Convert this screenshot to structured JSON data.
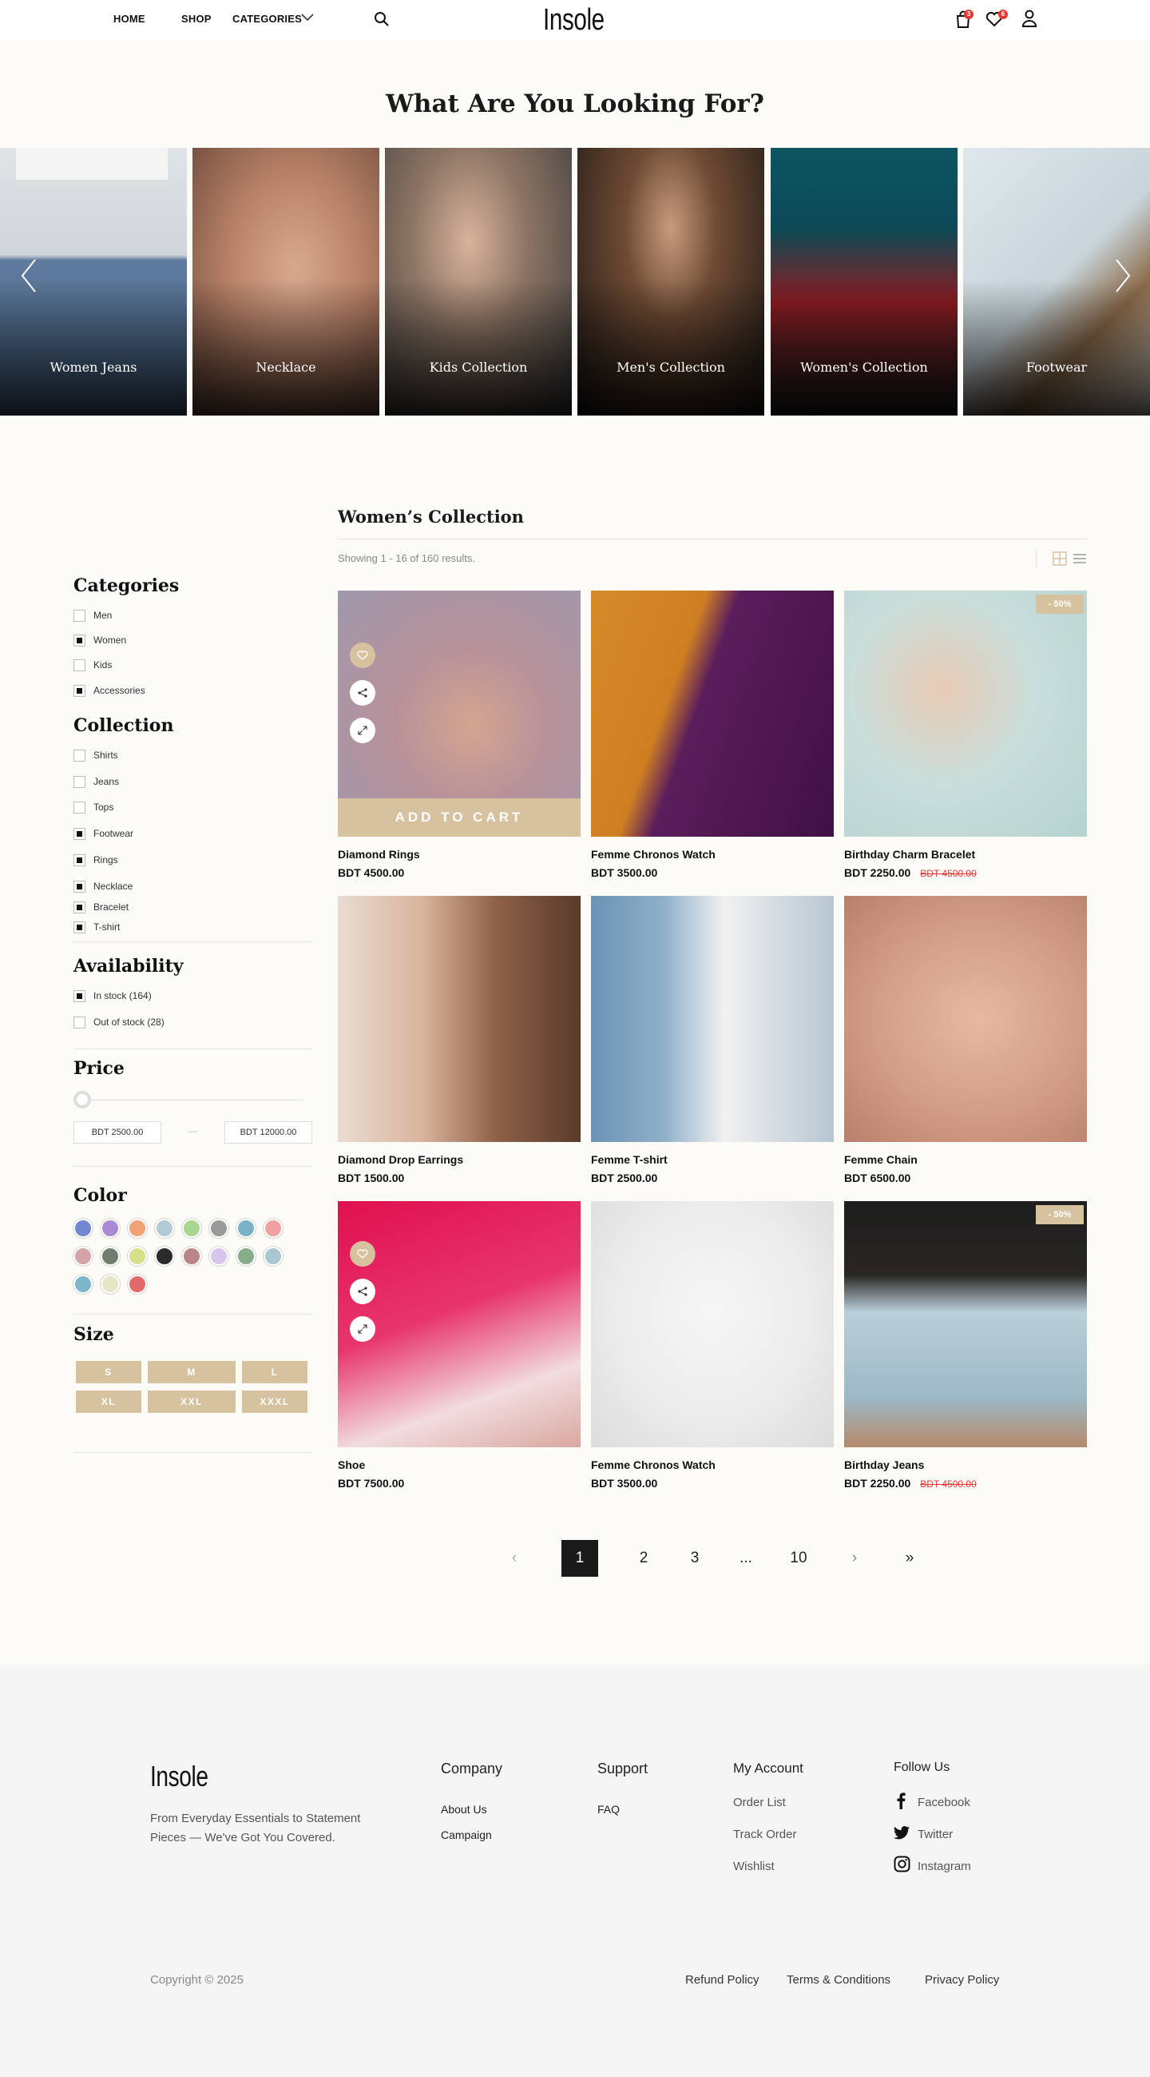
{
  "header": {
    "nav": [
      "HOME",
      "SHOP",
      "CATEGORIES"
    ],
    "logo": "Insole",
    "cart_count": "3",
    "wishlist_count": "6"
  },
  "hero": {
    "title": "What Are You Looking For?",
    "categories": [
      "Women Jeans",
      "Necklace",
      "Kids Collection",
      "Men's Collection",
      "Women's Collection",
      "Footwear"
    ]
  },
  "listing": {
    "title": "Women’s Collection",
    "results": "Showing 1 - 16 of 160 results."
  },
  "sidebar": {
    "categories_title": "Categories",
    "categories": [
      {
        "label": "Men",
        "checked": false
      },
      {
        "label": "Women",
        "checked": true
      },
      {
        "label": "Kids",
        "checked": false
      },
      {
        "label": "Accessories",
        "checked": true
      }
    ],
    "collection_title": "Collection",
    "collection": [
      {
        "label": "Shirts",
        "checked": false
      },
      {
        "label": "Jeans",
        "checked": false
      },
      {
        "label": "Tops",
        "checked": false
      },
      {
        "label": "Footwear",
        "checked": true
      },
      {
        "label": "Rings",
        "checked": true
      },
      {
        "label": "Necklace",
        "checked": true
      },
      {
        "label": "Bracelet",
        "checked": true
      },
      {
        "label": "T-shirt",
        "checked": true
      }
    ],
    "availability_title": "Availability",
    "availability": [
      {
        "label": "In stock (164)",
        "checked": true
      },
      {
        "label": "Out of stock (28)",
        "checked": false
      }
    ],
    "price_title": "Price",
    "price_min": "BDT 2500.00",
    "price_sep": "—",
    "price_max": "BDT 12000.00",
    "color_title": "Color",
    "colors": [
      "#6f88cf",
      "#a98ad4",
      "#f0a274",
      "#b3cbd6",
      "#a9d68e",
      "#9a9a9a",
      "#7ab3c8",
      "#f2a0a0",
      "#d6a3a6",
      "#6f7d6f",
      "#d9e08a",
      "#2b2b2b",
      "#b98685",
      "#d7c6ec",
      "#86ad8c",
      "#a9c8d4",
      "#7fb7ca",
      "#e6e6c4",
      "#e26a6a"
    ],
    "size_title": "Size",
    "sizes": [
      "S",
      "M",
      "L",
      "XL",
      "XXL",
      "XXXL"
    ]
  },
  "products": [
    {
      "name": "Diamond Rings",
      "price": "BDT 4500.00",
      "old": "",
      "sale": "",
      "cta": "ADD TO CART"
    },
    {
      "name": "Femme Chronos Watch",
      "price": "BDT 3500.00",
      "old": "",
      "sale": ""
    },
    {
      "name": "Birthday Charm Bracelet",
      "price": "BDT 2250.00",
      "old": "BDT 4500.00",
      "sale": "- 50%"
    },
    {
      "name": "Diamond Drop Earrings",
      "price": "BDT 1500.00",
      "old": "",
      "sale": ""
    },
    {
      "name": "Femme T-shirt",
      "price": "BDT 2500.00",
      "old": "",
      "sale": ""
    },
    {
      "name": "Femme Chain",
      "price": "BDT 6500.00",
      "old": "",
      "sale": ""
    },
    {
      "name": "Shoe",
      "price": "BDT 7500.00",
      "old": "",
      "sale": ""
    },
    {
      "name": "Femme Chronos Watch",
      "price": "BDT 3500.00",
      "old": "",
      "sale": ""
    },
    {
      "name": "Birthday Jeans",
      "price": "BDT 2250.00",
      "old": "BDT 4500.00",
      "sale": "- 50%"
    }
  ],
  "pagination": [
    "‹",
    "1",
    "2",
    "3",
    "...",
    "10",
    "›",
    "»"
  ],
  "footer": {
    "logo": "Insole",
    "tagline_1": "From Everyday Essentials to Statement",
    "tagline_2": "Pieces — We've Got You Covered.",
    "company_title": "Company",
    "company": [
      "About Us",
      "Campaign"
    ],
    "support_title": "Support",
    "support": [
      "FAQ"
    ],
    "account_title": "My Account",
    "account": [
      "Order List",
      "Track Order",
      "Wishlist"
    ],
    "follow_title": "Follow Us",
    "follow": [
      "Facebook",
      "Twitter",
      "Instagram"
    ],
    "copyright": "Copyright © 2025",
    "legal": [
      "Refund Policy",
      "Terms & Conditions",
      "Privacy Policy"
    ]
  }
}
